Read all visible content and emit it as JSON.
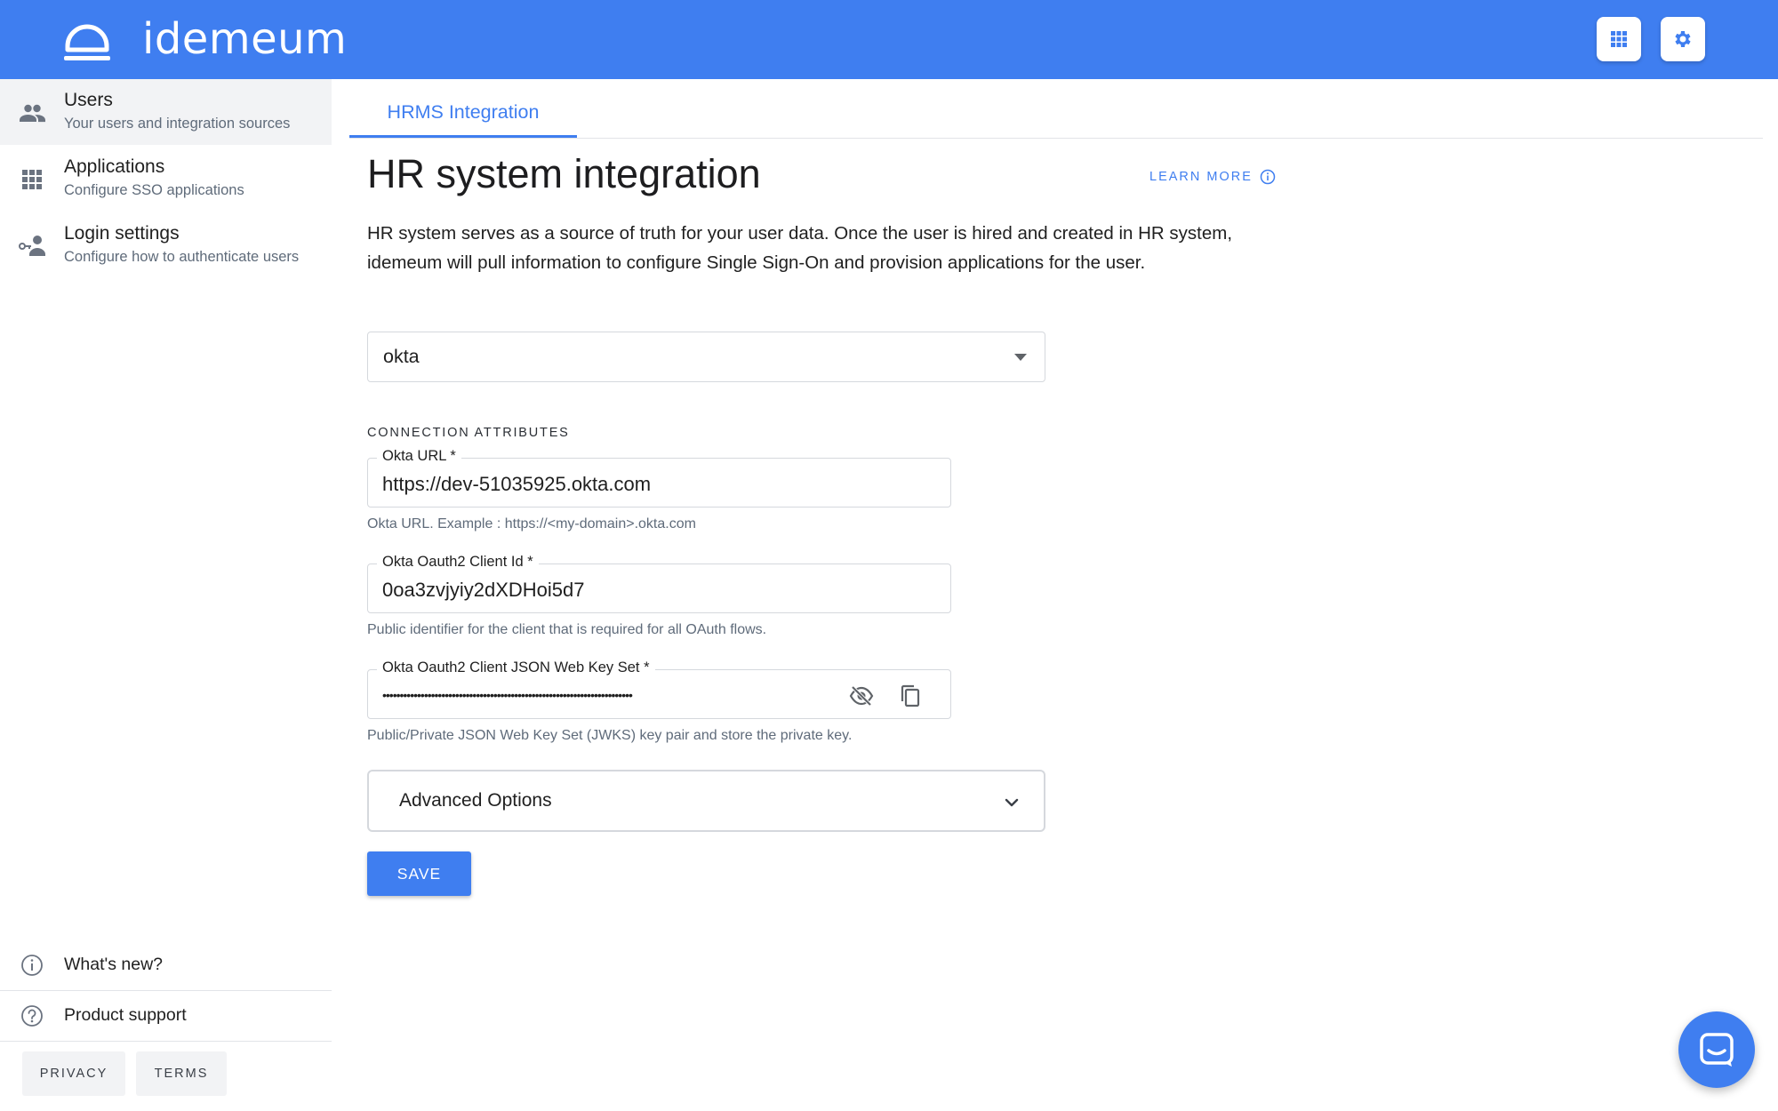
{
  "brand": {
    "name": "idemeum"
  },
  "colors": {
    "primary": "#3f7ef0",
    "sidebar_active": "#f2f3f5",
    "border": "#d5d8dd"
  },
  "header": {
    "actions": [
      {
        "icon": "apps-grid-icon"
      },
      {
        "icon": "gear-icon"
      }
    ]
  },
  "sidebar": {
    "items": [
      {
        "title": "Users",
        "subtitle": "Your users and integration sources",
        "icon": "users-icon",
        "active": true
      },
      {
        "title": "Applications",
        "subtitle": "Configure SSO applications",
        "icon": "apps-grid-icon",
        "active": false
      },
      {
        "title": "Login settings",
        "subtitle": "Configure how to authenticate users",
        "icon": "key-user-icon",
        "active": false
      }
    ],
    "bottom_links": [
      {
        "label": "What's new?",
        "icon": "info-circle-icon"
      },
      {
        "label": "Product support",
        "icon": "help-circle-icon"
      }
    ],
    "footer_buttons": {
      "privacy": "PRIVACY",
      "terms": "TERMS"
    }
  },
  "main": {
    "tab": "HRMS Integration",
    "title": "HR system integration",
    "learn_more": "LEARN MORE",
    "description": "HR system serves as a source of truth for your user data. Once the user is hired and created in HR system, idemeum will pull information to configure Single Sign-On and provision applications for the user.",
    "hr_system_select": {
      "value": "okta"
    },
    "section_label": "CONNECTION ATTRIBUTES",
    "fields": [
      {
        "label": "Okta URL *",
        "value": "https://dev-51035925.okta.com",
        "hint": "Okta URL. Example : https://<my-domain>.okta.com"
      },
      {
        "label": "Okta Oauth2 Client Id *",
        "value": "0oa3zvjyiy2dXDHoi5d7",
        "hint": "Public identifier for the client that is required for all OAuth flows."
      },
      {
        "label": "Okta Oauth2 Client JSON Web Key Set *",
        "value": "••••••••••••••••••••••••••••••••••••••••••••••••••••••••••••••••••••••••",
        "hint": "Public/Private JSON Web Key Set (JWKS) key pair and store the private key."
      }
    ],
    "advanced_options": "Advanced Options",
    "save_label": "SAVE"
  }
}
